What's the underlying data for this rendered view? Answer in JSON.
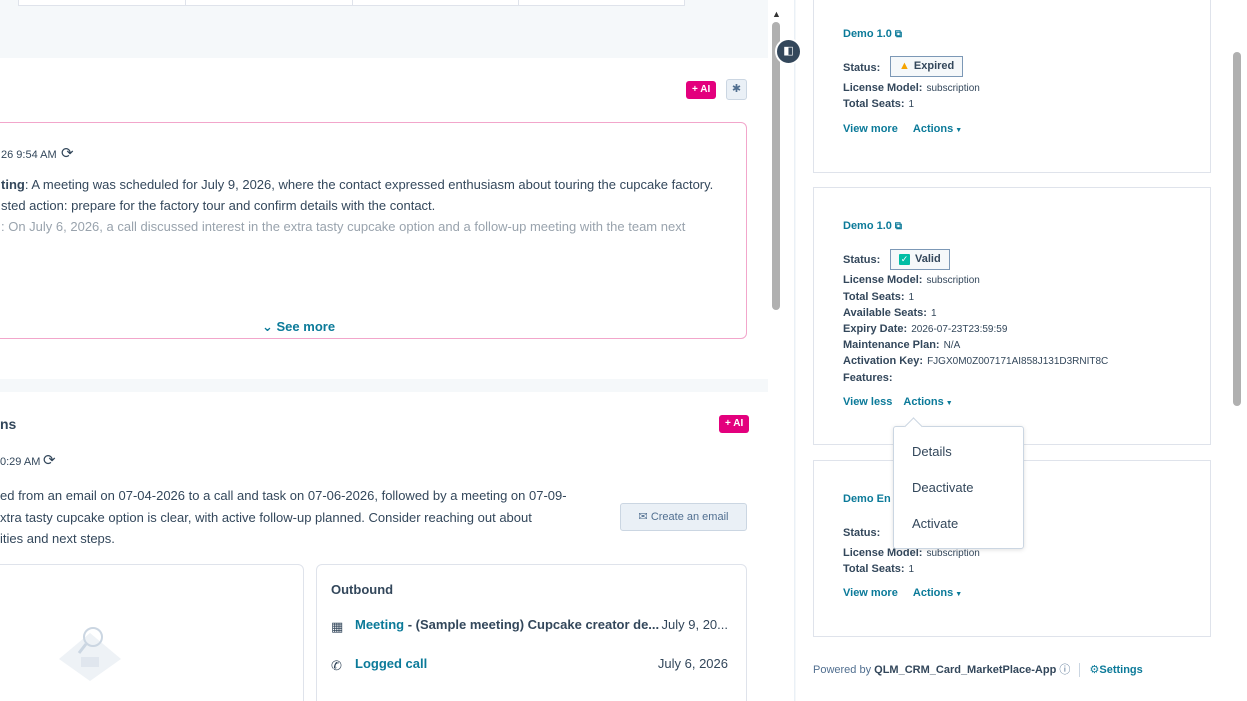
{
  "ai_badge": "+ AI",
  "summary": {
    "timestamp": "26 9:54 AM",
    "line1_bold": "ting",
    "line1_rest": ": A meeting was scheduled for July 9, 2026, where the contact expressed enthusiasm about touring the cupcake factory.",
    "line2": "sted action: prepare for the factory tour and confirm details with the contact.",
    "line3": ": On July 6, 2026, a call discussed interest in the extra tasty cupcake option and a follow-up meeting with the team next",
    "see_more": "See more"
  },
  "insights": {
    "title": "ns",
    "timestamp": "0:29 AM",
    "para1": "ed from an email on 07-04-2026 to a call and task on 07-06-2026, followed by a meeting on 07-09-",
    "para2": "xtra tasty cupcake option is clear, with active follow-up planned. Consider reaching out about",
    "para3": "ities and next steps.",
    "create_email": "Create an email",
    "outbound": {
      "title": "Outbound",
      "items": [
        {
          "label": "Meeting",
          "rest": " - (Sample meeting) Cupcake creator de...",
          "date": "July 9, 20..."
        },
        {
          "label": "Logged call",
          "rest": "",
          "date": "July 6, 2026"
        }
      ]
    }
  },
  "licenses": [
    {
      "title": "Demo 1.0",
      "status_label": "Status:",
      "status": "Expired",
      "rows": [
        {
          "k": "License Model:",
          "v": "subscription"
        },
        {
          "k": "Total Seats:",
          "v": "1"
        }
      ],
      "view_link": "View more",
      "actions": "Actions"
    },
    {
      "title": "Demo 1.0",
      "status_label": "Status:",
      "status": "Valid",
      "rows": [
        {
          "k": "License Model:",
          "v": "subscription"
        },
        {
          "k": "Total Seats:",
          "v": "1"
        },
        {
          "k": "Available Seats:",
          "v": "1"
        },
        {
          "k": "Expiry Date:",
          "v": "2026-07-23T23:59:59"
        },
        {
          "k": "Maintenance Plan:",
          "v": "N/A"
        },
        {
          "k": "Activation Key:",
          "v": "FJGX0M0Z007171AI858J131D3RNIT8C"
        },
        {
          "k": "Features:",
          "v": ""
        }
      ],
      "view_link": "View less",
      "actions": "Actions"
    },
    {
      "title": "Demo En",
      "status_label": "Status:",
      "rows": [
        {
          "k": "License Model:",
          "v": "subscription"
        },
        {
          "k": "Total Seats:",
          "v": "1"
        }
      ],
      "view_link": "View more",
      "actions": "Actions"
    }
  ],
  "dropdown": [
    "Details",
    "Deactivate",
    "Activate"
  ],
  "footer": {
    "powered_by": "Powered by",
    "app_name": "QLM_CRM_Card_MarketPlace-App",
    "settings": "Settings"
  }
}
